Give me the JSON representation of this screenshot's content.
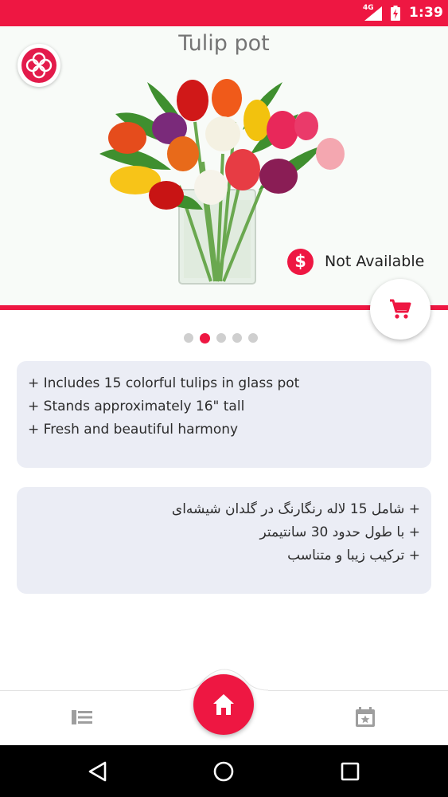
{
  "status_bar": {
    "network": "4G",
    "time": "1:39"
  },
  "product": {
    "title": "Tulip pot",
    "price_icon_symbol": "$",
    "availability": "Not Available"
  },
  "pager": {
    "count": 5,
    "active_index": 1
  },
  "description_en": [
    "+ Includes 15 colorful tulips in glass pot",
    "+ Stands approximately 16\" tall",
    "+ Fresh and beautiful harmony"
  ],
  "description_fa": [
    "+ شامل 15 لاله رنگارنگ در گلدان شیشه‌ای",
    "+ با طول حدود 30 سانتیمتر",
    "+ ترکیب زیبا و متناسب"
  ],
  "icons": {
    "logo": "brand-knot-logo",
    "cart": "shopping-cart-icon",
    "price": "dollar-circle-icon",
    "list": "list-icon",
    "home": "home-icon",
    "calendar": "calendar-star-icon"
  },
  "colors": {
    "accent": "#ee1742",
    "card_bg": "#ebedf5",
    "hero_bg": "#f8fbf8"
  }
}
